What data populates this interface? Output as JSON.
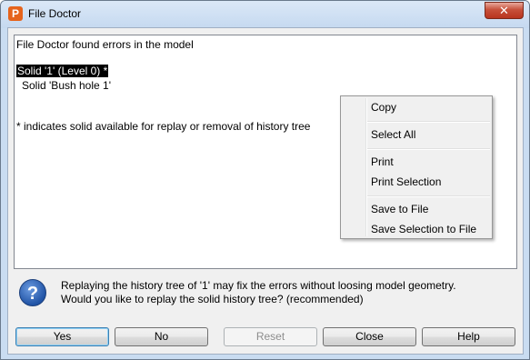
{
  "window": {
    "title": "File Doctor",
    "app_icon_glyph": "P",
    "close_glyph": "✕"
  },
  "report": {
    "lines": [
      "File Doctor found errors in the model",
      "Solid '1' (Level 0) *",
      "Solid 'Bush hole 1'",
      "* indicates solid available for replay or removal of history tree"
    ]
  },
  "context_menu": {
    "items": [
      "Copy",
      "Select All",
      "Print",
      "Print Selection",
      "Save to File",
      "Save Selection to File"
    ]
  },
  "message": {
    "icon_glyph": "?",
    "line1": "Replaying the history tree of '1' may fix the errors without loosing model geometry.",
    "line2": "Would you like to replay the solid history tree? (recommended)"
  },
  "buttons": {
    "yes": "Yes",
    "no": "No",
    "reset": "Reset",
    "close": "Close",
    "help": "Help"
  },
  "colors": {
    "title_bar": "#c5d9f0",
    "close_button": "#c7503a",
    "selection": "#000000",
    "help_icon": "#2154a6"
  }
}
